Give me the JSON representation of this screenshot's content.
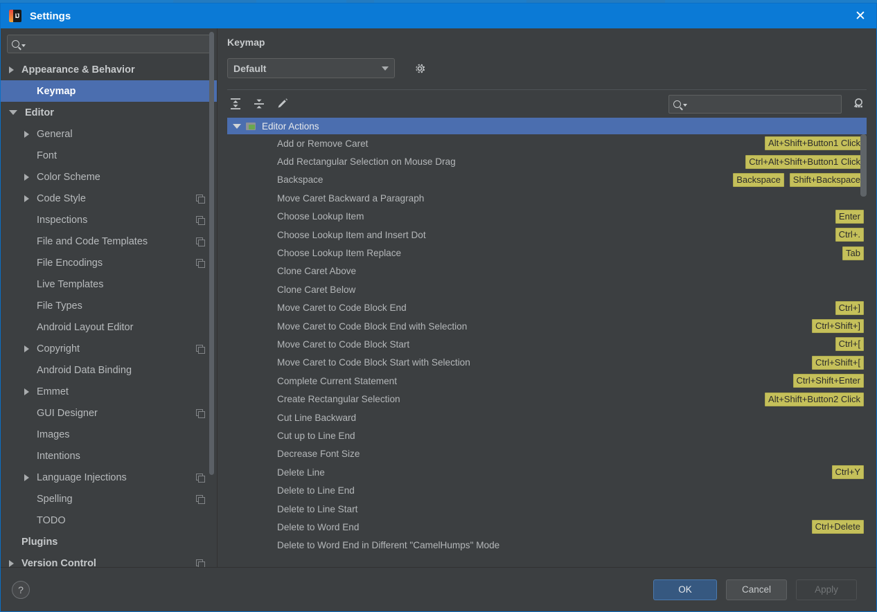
{
  "window": {
    "title": "Settings",
    "app_icon": "intellij-idea-icon",
    "close_icon": "close-icon",
    "titlebar_color": "#0b7ad6"
  },
  "sidebar": {
    "search": {
      "placeholder": "",
      "value": "",
      "icon": "search-icon"
    },
    "items": [
      {
        "label": "Appearance & Behavior",
        "level": 0,
        "arrow": "collapsed",
        "bold": true,
        "copy": false,
        "selected": false
      },
      {
        "label": "Keymap",
        "level": 1,
        "arrow": "none",
        "bold": true,
        "copy": false,
        "selected": true
      },
      {
        "label": "Editor",
        "level": 0,
        "arrow": "expanded",
        "bold": true,
        "copy": false,
        "selected": false
      },
      {
        "label": "General",
        "level": 1,
        "arrow": "collapsed",
        "bold": false,
        "copy": false,
        "selected": false
      },
      {
        "label": "Font",
        "level": 1,
        "arrow": "none",
        "bold": false,
        "copy": false,
        "selected": false
      },
      {
        "label": "Color Scheme",
        "level": 1,
        "arrow": "collapsed",
        "bold": false,
        "copy": false,
        "selected": false
      },
      {
        "label": "Code Style",
        "level": 1,
        "arrow": "collapsed",
        "bold": false,
        "copy": true,
        "selected": false
      },
      {
        "label": "Inspections",
        "level": 1,
        "arrow": "none",
        "bold": false,
        "copy": true,
        "selected": false
      },
      {
        "label": "File and Code Templates",
        "level": 1,
        "arrow": "none",
        "bold": false,
        "copy": true,
        "selected": false
      },
      {
        "label": "File Encodings",
        "level": 1,
        "arrow": "none",
        "bold": false,
        "copy": true,
        "selected": false
      },
      {
        "label": "Live Templates",
        "level": 1,
        "arrow": "none",
        "bold": false,
        "copy": false,
        "selected": false
      },
      {
        "label": "File Types",
        "level": 1,
        "arrow": "none",
        "bold": false,
        "copy": false,
        "selected": false
      },
      {
        "label": "Android Layout Editor",
        "level": 1,
        "arrow": "none",
        "bold": false,
        "copy": false,
        "selected": false
      },
      {
        "label": "Copyright",
        "level": 1,
        "arrow": "collapsed",
        "bold": false,
        "copy": true,
        "selected": false
      },
      {
        "label": "Android Data Binding",
        "level": 1,
        "arrow": "none",
        "bold": false,
        "copy": false,
        "selected": false
      },
      {
        "label": "Emmet",
        "level": 1,
        "arrow": "collapsed",
        "bold": false,
        "copy": false,
        "selected": false
      },
      {
        "label": "GUI Designer",
        "level": 1,
        "arrow": "none",
        "bold": false,
        "copy": true,
        "selected": false
      },
      {
        "label": "Images",
        "level": 1,
        "arrow": "none",
        "bold": false,
        "copy": false,
        "selected": false
      },
      {
        "label": "Intentions",
        "level": 1,
        "arrow": "none",
        "bold": false,
        "copy": false,
        "selected": false
      },
      {
        "label": "Language Injections",
        "level": 1,
        "arrow": "collapsed",
        "bold": false,
        "copy": true,
        "selected": false
      },
      {
        "label": "Spelling",
        "level": 1,
        "arrow": "none",
        "bold": false,
        "copy": true,
        "selected": false
      },
      {
        "label": "TODO",
        "level": 1,
        "arrow": "none",
        "bold": false,
        "copy": false,
        "selected": false
      },
      {
        "label": "Plugins",
        "level": 0,
        "arrow": "none",
        "bold": true,
        "copy": false,
        "selected": false
      },
      {
        "label": "Version Control",
        "level": 0,
        "arrow": "collapsed",
        "bold": true,
        "copy": true,
        "selected": false
      }
    ],
    "selection_color": "#4b6eaf"
  },
  "panel": {
    "title": "Keymap",
    "scheme": {
      "value": "Default",
      "dropdown_icon": "chevron-down-icon"
    },
    "gear_icon": "gear-icon",
    "toolbar": [
      {
        "icon": "expand-all-icon",
        "name": "expand-all-button"
      },
      {
        "icon": "collapse-all-icon",
        "name": "collapse-all-button"
      },
      {
        "icon": "edit-pencil-icon",
        "name": "edit-shortcut-button"
      }
    ],
    "search": {
      "placeholder": "",
      "value": "",
      "icon": "search-icon"
    },
    "shortcut_search_icon": "find-by-shortcut-icon",
    "group": {
      "label": "Editor Actions",
      "icon": "editor-actions-folder-icon",
      "expanded": true
    },
    "actions": [
      {
        "name": "Add or Remove Caret",
        "keys": [
          "Alt+Shift+Button1 Click"
        ]
      },
      {
        "name": "Add Rectangular Selection on Mouse Drag",
        "keys": [
          "Ctrl+Alt+Shift+Button1 Click"
        ]
      },
      {
        "name": "Backspace",
        "keys": [
          "Backspace",
          "Shift+Backspace"
        ]
      },
      {
        "name": "Move Caret Backward a Paragraph",
        "keys": []
      },
      {
        "name": "Choose Lookup Item",
        "keys": [
          "Enter"
        ]
      },
      {
        "name": "Choose Lookup Item and Insert Dot",
        "keys": [
          "Ctrl+."
        ]
      },
      {
        "name": "Choose Lookup Item Replace",
        "keys": [
          "Tab"
        ]
      },
      {
        "name": "Clone Caret Above",
        "keys": []
      },
      {
        "name": "Clone Caret Below",
        "keys": []
      },
      {
        "name": "Move Caret to Code Block End",
        "keys": [
          "Ctrl+]"
        ]
      },
      {
        "name": "Move Caret to Code Block End with Selection",
        "keys": [
          "Ctrl+Shift+]"
        ]
      },
      {
        "name": "Move Caret to Code Block Start",
        "keys": [
          "Ctrl+["
        ]
      },
      {
        "name": "Move Caret to Code Block Start with Selection",
        "keys": [
          "Ctrl+Shift+["
        ]
      },
      {
        "name": "Complete Current Statement",
        "keys": [
          "Ctrl+Shift+Enter"
        ]
      },
      {
        "name": "Create Rectangular Selection",
        "keys": [
          "Alt+Shift+Button2 Click"
        ]
      },
      {
        "name": "Cut Line Backward",
        "keys": []
      },
      {
        "name": "Cut up to Line End",
        "keys": []
      },
      {
        "name": "Decrease Font Size",
        "keys": []
      },
      {
        "name": "Delete Line",
        "keys": [
          "Ctrl+Y"
        ]
      },
      {
        "name": "Delete to Line End",
        "keys": []
      },
      {
        "name": "Delete to Line Start",
        "keys": []
      },
      {
        "name": "Delete to Word End",
        "keys": [
          "Ctrl+Delete"
        ]
      },
      {
        "name": "Delete to Word End in Different \"CamelHumps\" Mode",
        "keys": []
      }
    ],
    "shortcut_badge_color": "#c5c05a"
  },
  "footer": {
    "help_label": "?",
    "ok_label": "OK",
    "cancel_label": "Cancel",
    "apply_label": "Apply",
    "apply_enabled": false,
    "ok_color": "#365880"
  }
}
